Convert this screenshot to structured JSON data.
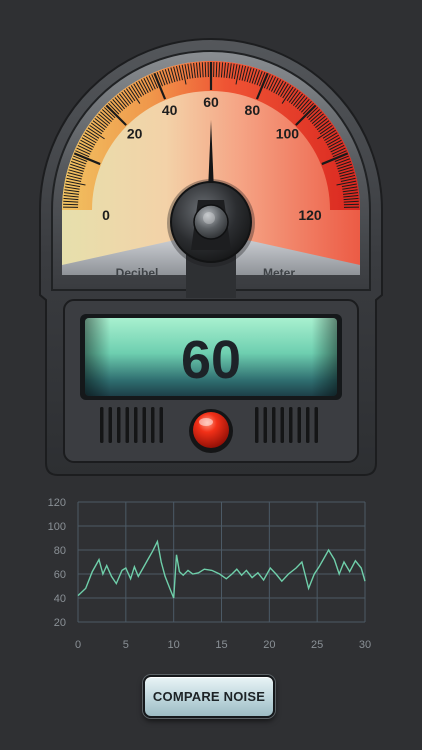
{
  "meter": {
    "scale_labels": [
      "0",
      "20",
      "40",
      "60",
      "80",
      "100",
      "120"
    ],
    "scale_values": [
      0,
      20,
      40,
      60,
      80,
      100,
      120
    ],
    "scale_min": -20,
    "scale_max": 140,
    "left_label": "Decibel",
    "right_label": "Meter",
    "needle_value": 60,
    "display_value": "60",
    "colors": {
      "warm": "#f0a048",
      "red": "#e83020",
      "display": "#7fd8b6"
    }
  },
  "compare_button": {
    "label": "COMPARE NOISE"
  },
  "chart_data": {
    "type": "line",
    "title": "",
    "xlabel": "",
    "ylabel": "",
    "xlim": [
      0,
      30
    ],
    "ylim": [
      20,
      120
    ],
    "grid": true,
    "x_ticks": [
      0,
      5,
      10,
      15,
      20,
      25,
      30
    ],
    "y_ticks": [
      20,
      40,
      60,
      80,
      100,
      120
    ],
    "x_tick_labels": [
      "0",
      "5",
      "10",
      "15",
      "20",
      "25",
      "30"
    ],
    "y_tick_labels": [
      "20",
      "40",
      "60",
      "80",
      "100",
      "120"
    ],
    "series": [
      {
        "color": "#6fcfaa",
        "x": [
          0,
          0.8,
          1.5,
          2.2,
          2.6,
          3.0,
          3.5,
          4.0,
          4.6,
          5.0,
          5.5,
          5.9,
          6.3,
          6.8,
          7.3,
          7.8,
          8.3,
          8.7,
          9.1,
          9.6,
          10.0,
          10.3,
          10.6,
          11.0,
          11.5,
          12.0,
          12.6,
          13.2,
          14.0,
          14.8,
          15.5,
          16.1,
          16.6,
          17.1,
          17.6,
          18.2,
          18.8,
          19.4,
          20.1,
          20.7,
          21.3,
          22.0,
          22.8,
          23.4,
          24.1,
          24.7,
          25.2,
          25.7,
          26.2,
          26.8,
          27.3,
          27.8,
          28.4,
          29.0,
          29.6,
          30.0
        ],
        "y": [
          42,
          48,
          62,
          72,
          60,
          67,
          58,
          52,
          63,
          65,
          56,
          66,
          58,
          65,
          72,
          79,
          87,
          70,
          58,
          48,
          40,
          76,
          62,
          59,
          63,
          60,
          61,
          64,
          63,
          60,
          56,
          60,
          64,
          59,
          63,
          57,
          61,
          55,
          65,
          60,
          54,
          60,
          65,
          70,
          48,
          60,
          66,
          73,
          80,
          72,
          60,
          70,
          62,
          71,
          65,
          54
        ]
      }
    ]
  }
}
